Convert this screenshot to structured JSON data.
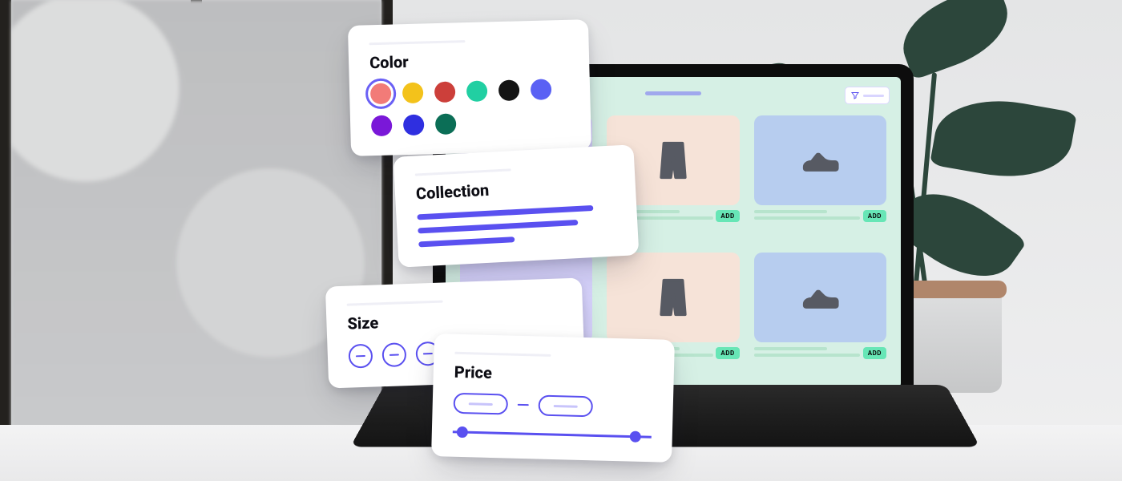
{
  "filters": {
    "color": {
      "title": "Color",
      "swatches": [
        {
          "hex": "#f27b78",
          "selected": true
        },
        {
          "hex": "#f3c21b",
          "selected": false
        },
        {
          "hex": "#cc3f3a",
          "selected": false
        },
        {
          "hex": "#21cfa2",
          "selected": false
        },
        {
          "hex": "#141414",
          "selected": false
        },
        {
          "hex": "#5a61f4",
          "selected": false
        },
        {
          "hex": "#7a18d8",
          "selected": false
        },
        {
          "hex": "#2f2fe0",
          "selected": false
        },
        {
          "hex": "#0b6e56",
          "selected": false
        }
      ]
    },
    "collection": {
      "title": "Collection"
    },
    "size": {
      "title": "Size",
      "option_count": 5
    },
    "price": {
      "title": "Price",
      "knob_left_pct": 5,
      "knob_right_pct": 92
    }
  },
  "storefront": {
    "add_label": "ADD",
    "products": [
      {
        "icon": "shirt",
        "tile": "c-lav"
      },
      {
        "icon": "pants",
        "tile": "c-peach"
      },
      {
        "icon": "shoe",
        "tile": "c-blue"
      },
      {
        "icon": "shirt",
        "tile": "c-lav"
      },
      {
        "icon": "pants",
        "tile": "c-peach"
      },
      {
        "icon": "shoe",
        "tile": "c-blue"
      }
    ]
  },
  "accent": "#5a50f0"
}
